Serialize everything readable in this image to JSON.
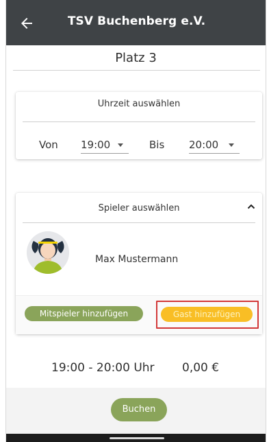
{
  "header": {
    "title": "TSV Buchenberg e.V.",
    "back_icon": "arrow-left-icon"
  },
  "court": {
    "name": "Platz 3"
  },
  "time_card": {
    "header": "Uhrzeit auswählen",
    "from_label": "Von",
    "from_value": "19:00",
    "to_label": "Bis",
    "to_value": "20:00"
  },
  "players_card": {
    "header": "Spieler auswählen",
    "toggle_icon": "chevron-up-icon",
    "players": [
      {
        "name": "Max Mustermann",
        "avatar_icon": "avatar-icon"
      }
    ],
    "add_teammate_label": "Mitspieler hinzufügen",
    "add_guest_label": "Gast hinzufügen"
  },
  "summary": {
    "time_range": "19:00 - 20:00 Uhr",
    "price": "0,00 €"
  },
  "footer": {
    "book_label": "Buchen"
  },
  "colors": {
    "app_bar": "#3f4346",
    "primary_green": "#8aa45a",
    "guest_yellow": "#f9be25",
    "highlight_red": "#d23737",
    "bottom_bar": "#f3f3f3"
  }
}
